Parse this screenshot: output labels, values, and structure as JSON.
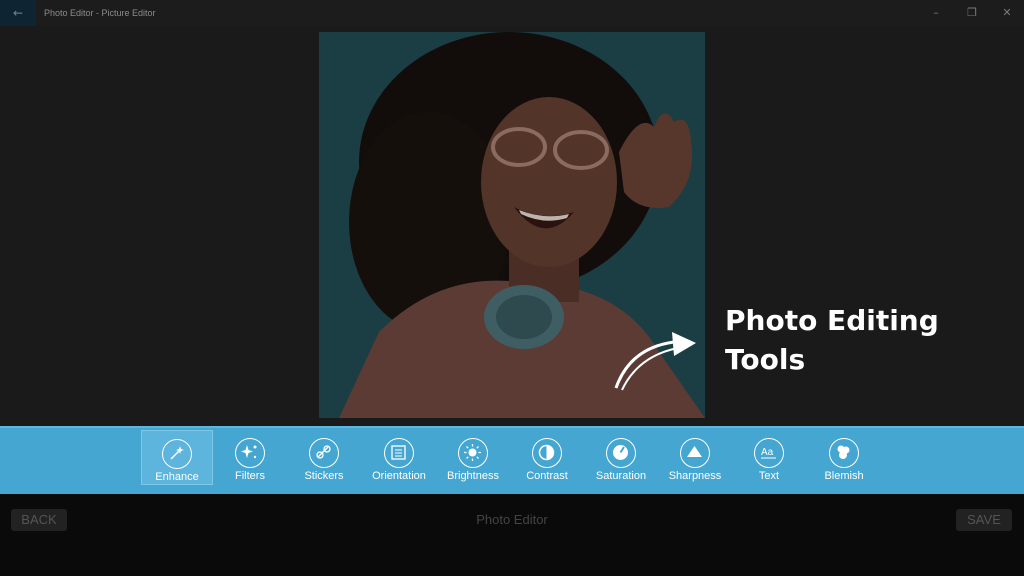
{
  "window": {
    "title": "Photo Editor - Picture Editor",
    "back_glyph": "←",
    "minimize_glyph": "–",
    "maximize_glyph": "❐",
    "close_glyph": "✕"
  },
  "annotation": {
    "line1": "Photo Editing",
    "line2": "Tools"
  },
  "tools": [
    {
      "label": "Enhance",
      "icon": "magic-wand-icon",
      "active": true
    },
    {
      "label": "Filters",
      "icon": "sparkles-icon",
      "active": false
    },
    {
      "label": "Stickers",
      "icon": "sticker-icon",
      "active": false
    },
    {
      "label": "Orientation",
      "icon": "orientation-icon",
      "active": false
    },
    {
      "label": "Brightness",
      "icon": "sun-icon",
      "active": false
    },
    {
      "label": "Contrast",
      "icon": "contrast-icon",
      "active": false
    },
    {
      "label": "Saturation",
      "icon": "saturation-icon",
      "active": false
    },
    {
      "label": "Sharpness",
      "icon": "triangle-icon",
      "active": false
    },
    {
      "label": "Text",
      "icon": "text-icon",
      "active": false
    },
    {
      "label": "Blemish",
      "icon": "blemish-icon",
      "active": false
    }
  ],
  "bottom": {
    "back_label": "BACK",
    "title": "Photo Editor",
    "save_label": "SAVE"
  },
  "colors": {
    "toolbar": "#45a6d2",
    "active_tool": "#5db4dd",
    "background": "#151515"
  }
}
